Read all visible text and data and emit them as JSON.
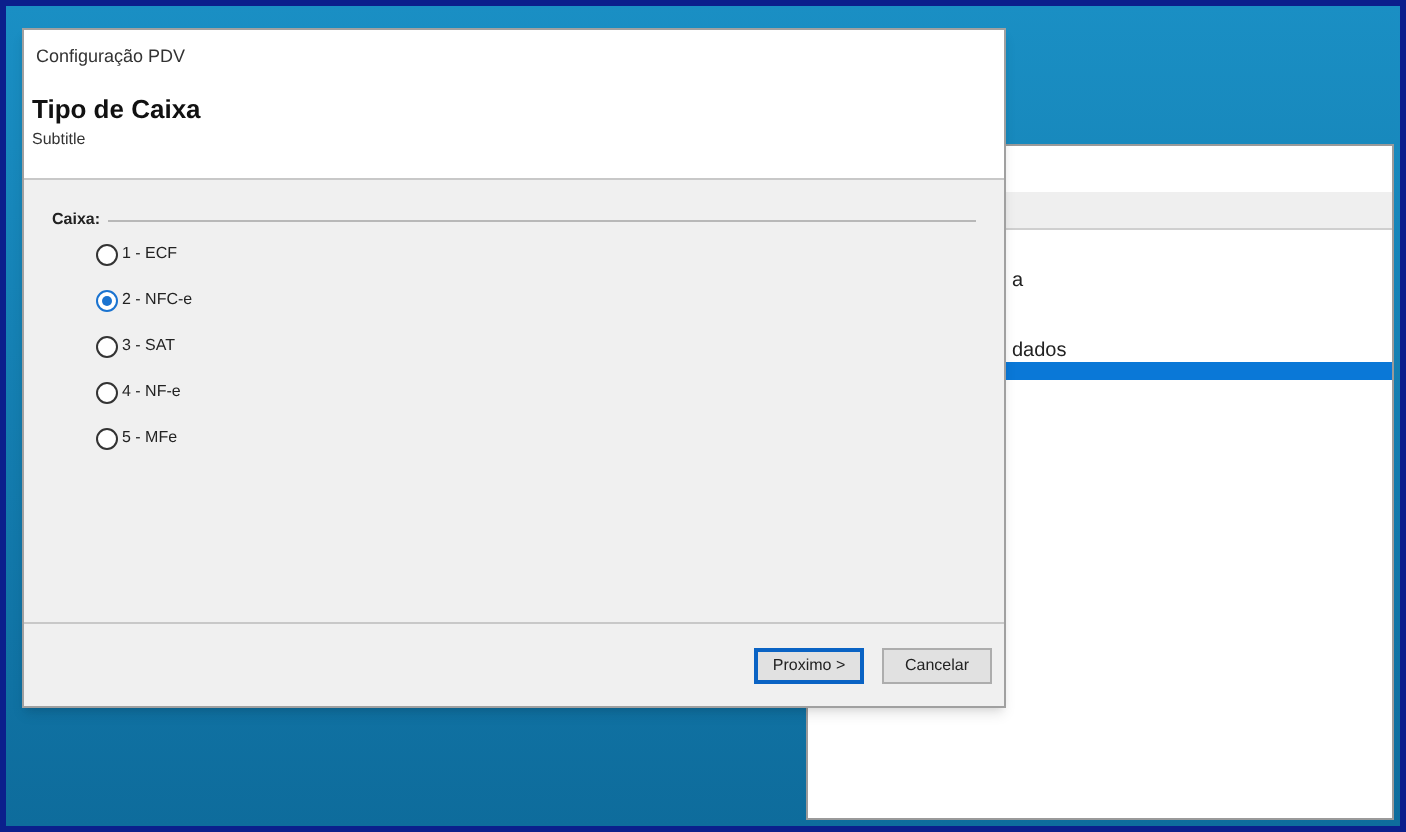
{
  "background_window": {
    "rows": [
      {
        "label": "a",
        "selected": false
      },
      {
        "label": "dados",
        "selected": false
      },
      {
        "selected": true
      }
    ]
  },
  "dialog": {
    "title": "Configuração PDV",
    "heading": "Tipo de Caixa",
    "subtitle": "Subtitle",
    "group": {
      "label": "Caixa:",
      "options": [
        {
          "label": "1 - ECF",
          "selected": false
        },
        {
          "label": "2 - NFC-e",
          "selected": true
        },
        {
          "label": "3 - SAT",
          "selected": false
        },
        {
          "label": "4 - NF-e",
          "selected": false
        },
        {
          "label": "5 - MFe",
          "selected": false
        }
      ]
    },
    "buttons": [
      {
        "label": "Proximo >",
        "default": true
      },
      {
        "label": "Cancelar",
        "default": false
      }
    ]
  }
}
